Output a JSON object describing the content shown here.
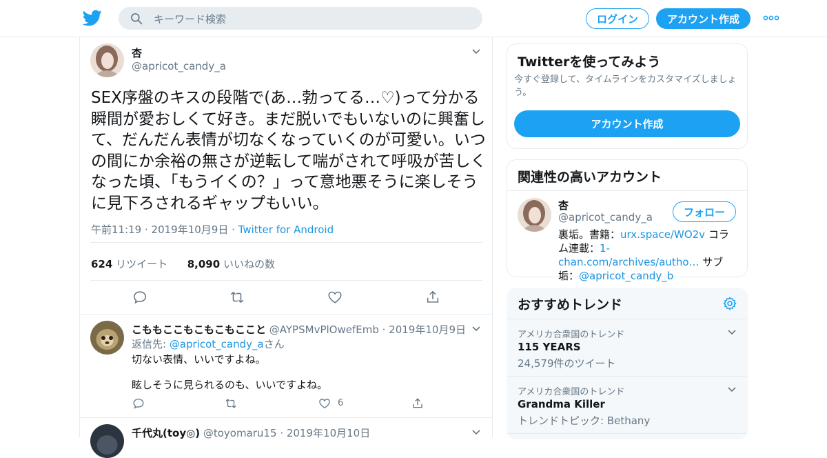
{
  "header": {
    "search_placeholder": "キーワード検索",
    "login_label": "ログイン",
    "signup_label": "アカウント作成"
  },
  "tweet": {
    "name": "杏",
    "handle": "@apricot_candy_a",
    "text": "SEX序盤のキスの段階で(あ…勃ってる…♡)って分かる瞬間が愛おしくて好き。まだ脱いでもいないのに興奮して、だんだん表情が切なくなっていくのが可愛い。いつの間にか余裕の無さが逆転して喘がされて呼吸が苦しくなった頃、「もうイくの？」って意地悪そうに楽しそうに見下ろされるギャップもいい。",
    "time": "午前11:19 · 2019年10月9日",
    "separator": " · ",
    "source": "Twitter for Android",
    "retweet_count": "624",
    "retweet_label": "リツイート",
    "like_count": "8,090",
    "like_label": "いいねの数"
  },
  "replies": [
    {
      "name": "こももここもこもこもここと",
      "handle": "@AYPSMvPlOwefEmb",
      "date": "· 2019年10月9日",
      "reply_prefix": "返信先: ",
      "reply_to": "@apricot_candy_a",
      "reply_suffix": "さん",
      "line1": "切ない表情、いいですよね。",
      "line2": "眩しそうに見られるのも、いいですよね。",
      "like_count": "6"
    },
    {
      "name": "千代丸(toy◎)",
      "handle": "@toyomaru15",
      "date": "· 2019年10月10日"
    }
  ],
  "sidebar": {
    "signup_card": {
      "title": "Twitterを使ってみよう",
      "desc": "今すぐ登録して、タイムラインをカスタマイズしましょう。",
      "button": "アカウント作成"
    },
    "related": {
      "title": "関連性の高いアカウント",
      "name": "杏",
      "handle": "@apricot_candy_a",
      "follow_label": "フォロー",
      "bio_1": "裏垢。書籍：",
      "bio_link1": "urx.space/WO2v",
      "bio_2": " コラム連載：",
      "bio_link2": "1-chan.com/archives/autho…",
      "bio_3": " サブ垢：",
      "bio_link3": "@apricot_candy_b"
    },
    "trends": {
      "title": "おすすめトレンド",
      "items": [
        {
          "context": "アメリカ合衆国のトレンド",
          "name": "115 YEARS",
          "sub": "24,579件のツイート"
        },
        {
          "context": "アメリカ合衆国のトレンド",
          "name": "Grandma Killer",
          "sub": "トレンドトピック: Bethany"
        }
      ]
    }
  },
  "colors": {
    "accent": "#1da1f2",
    "link": "#1b95e0",
    "muted": "#657786",
    "border": "#e6ecf0",
    "trend_bg": "#f5f8fa"
  },
  "icons": [
    "twitter-bird-icon",
    "search-icon",
    "more-dots-icon",
    "chevron-down-icon",
    "reply-icon",
    "retweet-icon",
    "like-icon",
    "share-icon",
    "gear-icon"
  ]
}
